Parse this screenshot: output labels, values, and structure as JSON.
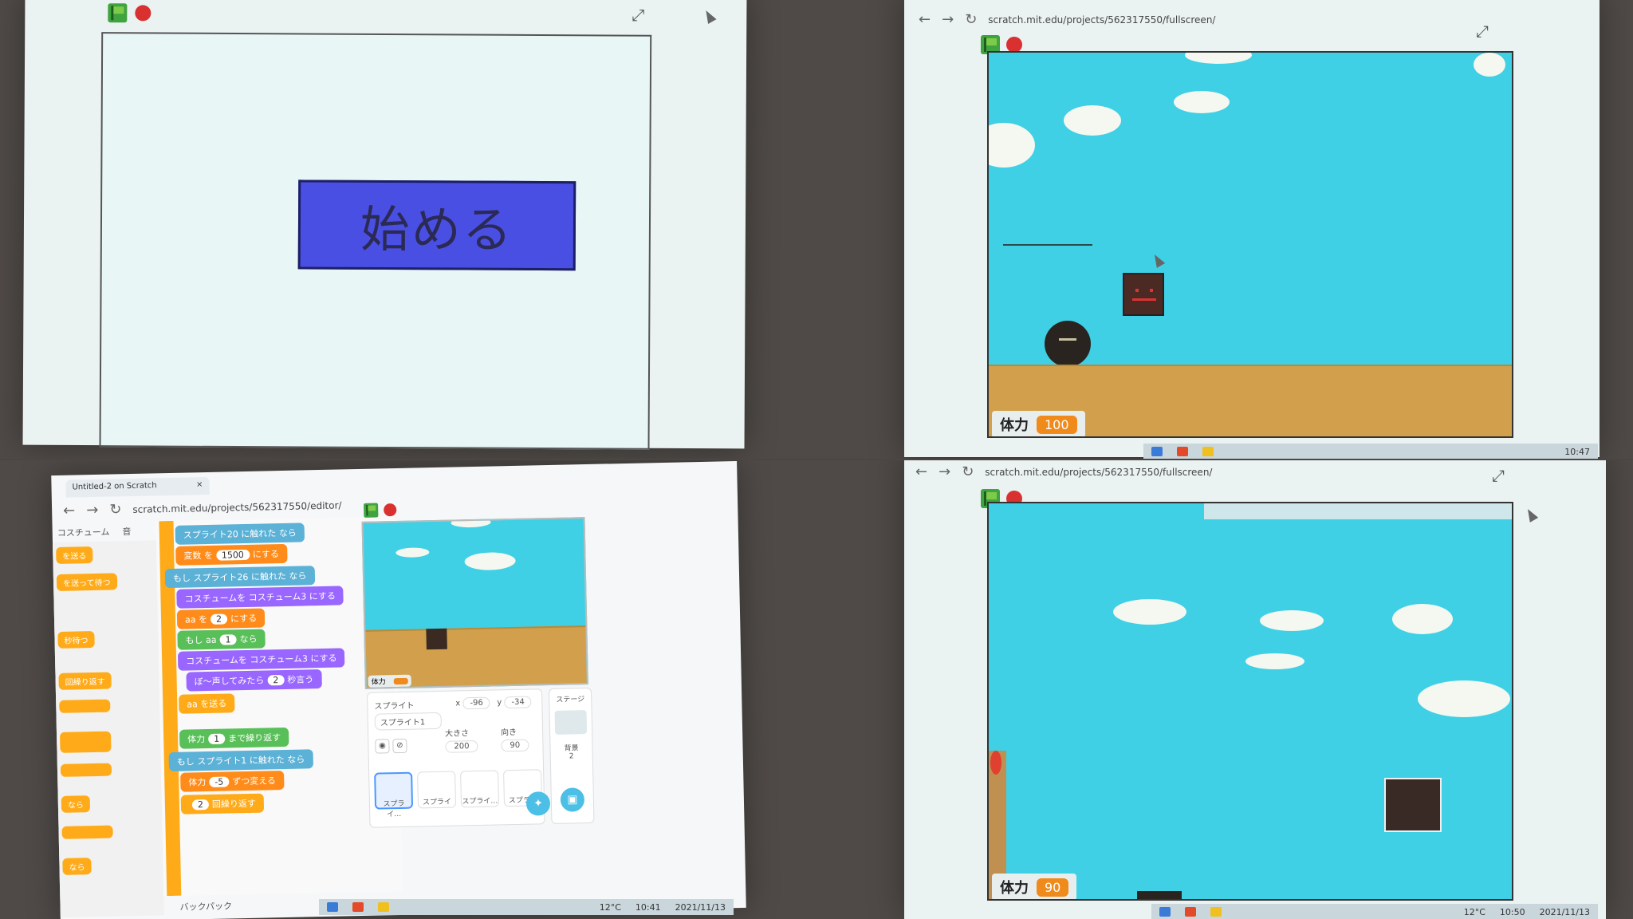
{
  "q1": {
    "start_button_label": "始める"
  },
  "q2": {
    "url": "scratch.mit.edu/projects/562317550/fullscreen/",
    "monitor_label": "体力",
    "monitor_value": "100",
    "clock_time": "10:47"
  },
  "q3": {
    "tab_title": "Untitled-2 on Scratch",
    "url": "scratch.mit.edu/projects/562317550/editor/",
    "tabs": [
      "コスチューム",
      "音"
    ],
    "palette_items": [
      "を送る",
      "を送って待つ",
      "秒待つ",
      "回繰り返す",
      "なら",
      "なら"
    ],
    "blocks": [
      {
        "text": "スプライト20 に触れた",
        "kind": "b-sens",
        "suffix": "なら"
      },
      {
        "text": "を",
        "pre": "変数",
        "value": "1500",
        "suffix": "にする",
        "kind": "b-var"
      },
      {
        "text": "スプライト26 に触れた",
        "pre": "もし",
        "suffix": "なら",
        "kind": "b-sens"
      },
      {
        "text": "コスチューム3",
        "pre": "コスチュームを",
        "suffix": "にする",
        "kind": "b-look"
      },
      {
        "text": "を",
        "pre": "aa",
        "value": "2",
        "suffix": "にする",
        "kind": "b-var"
      },
      {
        "text": "aa",
        "pre": "もし",
        "value": "1",
        "suffix": "なら",
        "kind": "b-op"
      },
      {
        "text": "コスチューム3",
        "pre": "コスチュームを",
        "suffix": "にする",
        "kind": "b-look"
      },
      {
        "text": "ぼ〜声してみたら",
        "value": "2",
        "suffix": "秒言う",
        "kind": "b-look"
      },
      {
        "text": "を送る",
        "pre": "aa",
        "kind": "b-ctl"
      },
      {
        "text": "体力",
        "value": "1",
        "suffix": "まで繰り返す",
        "kind": "b-op"
      },
      {
        "text": "スプライト1 に触れた",
        "pre": "もし",
        "suffix": "なら",
        "kind": "b-sens"
      },
      {
        "text": "体力",
        "pre": "",
        "value": "-5",
        "suffix": "ずつ変える",
        "kind": "b-var"
      },
      {
        "text": "回繰り返す",
        "value": "2",
        "kind": "b-ctl"
      }
    ],
    "monitor_label": "体力",
    "sprite_panel": {
      "title": "スプライト",
      "name": "スプライト1",
      "x_label": "x",
      "x_value": "-96",
      "y_label": "y",
      "y_value": "-34",
      "size_label": "大きさ",
      "size_value": "200",
      "direction_label": "向き",
      "direction_value": "90",
      "thumbs": [
        "スプライ…",
        "スプライ",
        "スプライ…",
        "スプライ"
      ]
    },
    "stage_panel": {
      "title": "ステージ",
      "backdrops_label": "背景",
      "backdrops_count": "2"
    },
    "backpack_label": "バックパック",
    "clock": {
      "temp": "12°C",
      "time": "10:41",
      "date": "2021/11/13"
    }
  },
  "q4": {
    "url": "scratch.mit.edu/projects/562317550/fullscreen/",
    "monitor_label": "体力",
    "monitor_value": "90",
    "clock": {
      "temp": "12°C",
      "time": "10:50",
      "date": "2021/11/13"
    }
  }
}
